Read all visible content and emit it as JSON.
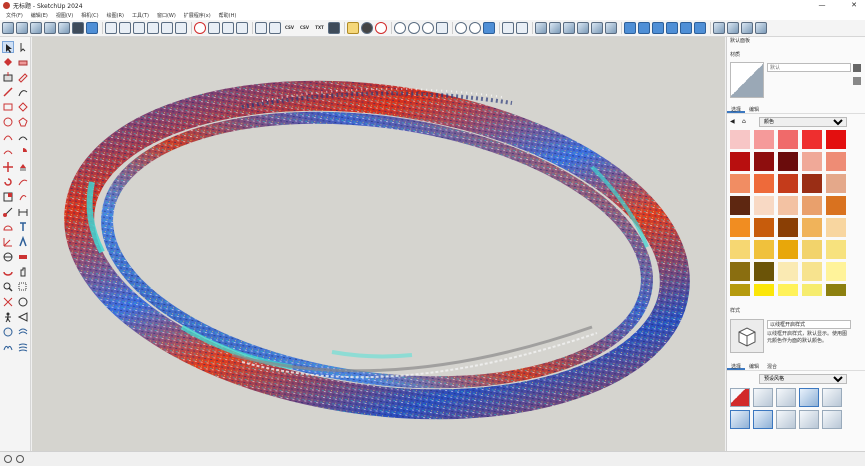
{
  "window": {
    "title": "无标题 - SketchUp 2024",
    "minimize": "—",
    "close": "✕"
  },
  "menu": [
    "文件(F)",
    "编辑(E)",
    "视图(V)",
    "相机(C)",
    "绘图(R)",
    "工具(T)",
    "窗口(W)",
    "扩展程序(x)",
    "帮助(H)"
  ],
  "toolbar": {
    "csv1": "CSV",
    "csv2": "CSV",
    "txt": "TXT"
  },
  "panel": {
    "tray_title": "默认面板",
    "materials_title": "材质",
    "material_name_placeholder": "默认",
    "tabs_materials": [
      "选择",
      "编辑"
    ],
    "collection": "颜色",
    "styles_title": "样式",
    "style_name": "以线框开启样式",
    "style_desc": "以线框开启样式，默认显示。使用图元颜色作为面的默认颜色。",
    "tabs_styles": [
      "选择",
      "编辑",
      "混合"
    ],
    "style_collection": "预设风格"
  },
  "colors": {
    "swatches": [
      "#f7c6c6",
      "#f59a9a",
      "#f06a6a",
      "#ee2f2f",
      "#e30f0f",
      "#b80f0f",
      "#8e0e0e",
      "#6a0c0c",
      "#f0a998",
      "#ee8c75",
      "#f18d63",
      "#ee6a3a",
      "#c43b1b",
      "#9a2e15",
      "#e4a88a",
      "#5e2711",
      "#f8d9c4",
      "#f3c2a3",
      "#e9a06c",
      "#d9721f",
      "#f18d21",
      "#c75c0c",
      "#8a3f05",
      "#f0b35a",
      "#f8d6a0",
      "#f6d772",
      "#f0c13c",
      "#e8a70a",
      "#f2d36b",
      "#f7e27e",
      "#8a6e10",
      "#6b5408",
      "#faeab3",
      "#f7e38e",
      "#fff39a",
      "#b59a0e",
      "#fbe60a",
      "#fff25a",
      "#f6ec6e",
      "#8c8010"
    ]
  }
}
